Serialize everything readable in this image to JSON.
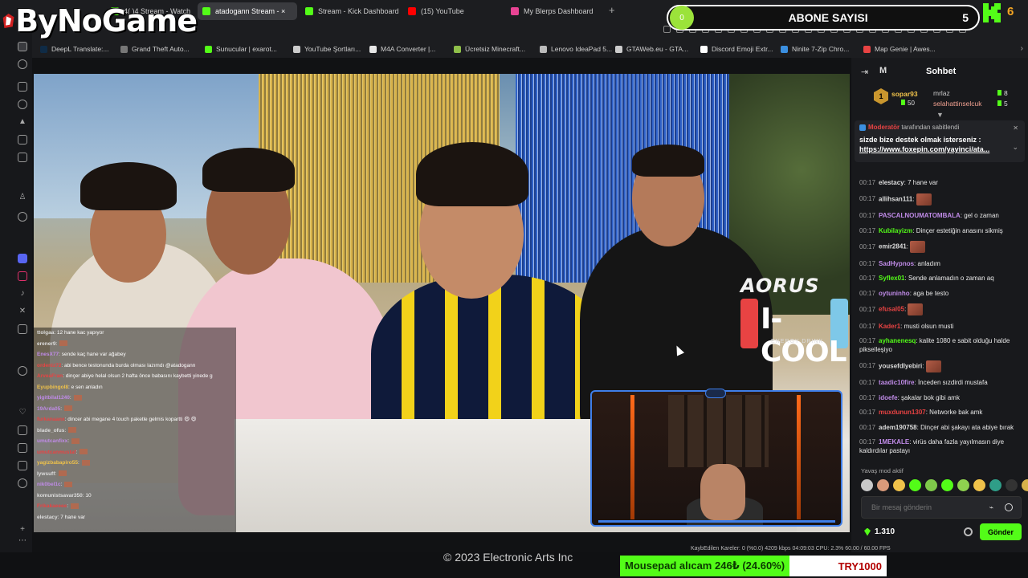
{
  "logo": {
    "text": "ByNoGame"
  },
  "tabs": [
    {
      "label": "4( )4 Stream - Watch",
      "color": "#53fc18"
    },
    {
      "label": "atadogann Stream - ×",
      "color": "#53fc18",
      "active": true
    },
    {
      "label": "Stream - Kick Dashboard",
      "color": "#53fc18"
    },
    {
      "label": "(15) YouTube",
      "color": "#ff0000"
    },
    {
      "label": "My Blerps Dashboard",
      "color": "#e84393"
    }
  ],
  "abone": {
    "label": "ABONE SAYISI",
    "count": "5",
    "ball": "0"
  },
  "kick_count": "6",
  "bookmarks": [
    {
      "label": "DeepL Translate:...",
      "color": "#0f2b46"
    },
    {
      "label": "Grand Theft Auto...",
      "color": "#777777"
    },
    {
      "label": "Sunucular | exarot...",
      "color": "#53fc18"
    },
    {
      "label": "YouTube Şortları...",
      "color": "#cccccc"
    },
    {
      "label": "M4A Converter |...",
      "color": "#e6e6e6"
    },
    {
      "label": "Ücretsiz Minecraft...",
      "color": "#8fbf4a"
    },
    {
      "label": "Lenovo IdeaPad 5...",
      "color": "#bbbbbb"
    },
    {
      "label": "GTAWeb.eu - GTA...",
      "color": "#cccccc"
    },
    {
      "label": "Discord Emoji Extr...",
      "color": "#ffffff"
    },
    {
      "label": "Ninite 7-Zip Chro...",
      "color": "#3b8fe0"
    },
    {
      "label": "Map Genie | Awes...",
      "color": "#e84343"
    }
  ],
  "video": {
    "aorus": "AORUS",
    "icool": "I-COOL",
    "energy": "ENERGY DRINK"
  },
  "overlay_chat": [
    {
      "u": "ttolgaa",
      "m": ": 12 hane kac yapıyor",
      "c": "#dddddd"
    },
    {
      "u": "erener9",
      "m": ":",
      "c": "#dddddd",
      "emo": true
    },
    {
      "u": "EnesX77",
      "m": ": sende kaç hane var ağabey",
      "c": "#c08be8"
    },
    {
      "u": "ordeniz72",
      "m": ": abi bence testonunda burda olması lazımdı @atadogann",
      "c": "#e84343"
    },
    {
      "u": "ArveaFran",
      "m": ": dinçer abiye helal olsun 2 hafta önce babasını kaybetti yinede g",
      "c": "#e84343"
    },
    {
      "u": "Eyupbingol8",
      "m": ": e sen anladın",
      "c": "#f0c24a"
    },
    {
      "u": "yigitbilal1240",
      "m": ":",
      "c": "#c08be8",
      "emo": true
    },
    {
      "u": "19Arda05",
      "m": ":",
      "c": "#c08be8",
      "emo": true
    },
    {
      "u": "furkanaanx",
      "m": ": dincer abi megane 4 touch paketle gelmis kopartti 😄 😄",
      "c": "#e84343"
    },
    {
      "u": "blade_ofus",
      "m": ":",
      "c": "#dddddd",
      "emo": true
    },
    {
      "u": "umutcanfixx",
      "m": ":",
      "c": "#c08be8",
      "emo": true
    },
    {
      "u": "umutcanmustaf",
      "m": ":",
      "c": "#e84343",
      "emo": true
    },
    {
      "u": "yagizbabapiro55",
      "m": ":",
      "c": "#f0c24a",
      "emo": true
    },
    {
      "u": "lywsuff",
      "m": ":",
      "c": "#dddddd",
      "emo": true
    },
    {
      "u": "nik0bel1c",
      "m": ":",
      "c": "#c08be8",
      "emo": true
    },
    {
      "u": "komunistsavar350",
      "m": ": 10",
      "c": "#dddddd"
    },
    {
      "u": "Frikakaeeee",
      "m": ":",
      "c": "#e84343",
      "emo": true
    },
    {
      "u": "elestacy",
      "m": ": 7 hane var",
      "c": "#dddddd"
    }
  ],
  "chat": {
    "title": "Sohbet",
    "m_label": "M",
    "leader": {
      "first": "sopar93",
      "first_score": "50",
      "second": "mrlaz",
      "second_score": "8",
      "third": "selahattinselcuk",
      "third_score": "5",
      "rank": "1"
    },
    "pinned": {
      "who": "Moderatör",
      "by": "tarafından sabitlendi",
      "text": "sizde bize destek olmak isterseniz :",
      "link": "https://www.foxepin.com/yayinci/ata..."
    },
    "messages": [
      {
        "t": "00:17",
        "u": "elestacy",
        "m": " 7 hane var",
        "c": "#dddddd"
      },
      {
        "t": "00:17",
        "u": "allihsan111",
        "m": "",
        "c": "#dddddd",
        "emo": true
      },
      {
        "t": "00:17",
        "u": "PASCALNOUMATOMBALA",
        "m": " gel o zaman",
        "c": "#c08be8"
      },
      {
        "t": "00:17",
        "u": "Kubilayizm",
        "m": " Dinçer estetiğin anasını sikmiş",
        "c": "#53fc18"
      },
      {
        "t": "00:17",
        "u": "emir2841",
        "m": "",
        "c": "#dddddd",
        "emo": true
      },
      {
        "t": "00:17",
        "u": "SadHypnos",
        "m": " anladım",
        "c": "#c08be8"
      },
      {
        "t": "00:17",
        "u": "Syflex01",
        "m": " Sende anlamadın o zaman aq",
        "c": "#53fc18"
      },
      {
        "t": "00:17",
        "u": "oytuninho",
        "m": " aga be testo",
        "c": "#c08be8"
      },
      {
        "t": "00:17",
        "u": "efusal05",
        "m": "",
        "c": "#e84343",
        "emo": true
      },
      {
        "t": "00:17",
        "u": "Kader1",
        "m": " musti olsun musti",
        "c": "#e84343"
      },
      {
        "t": "00:17",
        "u": "ayhanenesq",
        "m": " kalite 1080 e sabit olduğu halde pikselleşiyo",
        "c": "#53fc18"
      },
      {
        "t": "00:17",
        "u": "yousefdlyebiri",
        "m": "",
        "c": "#dddddd",
        "emo": true
      },
      {
        "t": "00:17",
        "u": "taadic10fire",
        "m": " İnceden sızdirdi mustafa",
        "c": "#c08be8"
      },
      {
        "t": "00:17",
        "u": "idoefe",
        "m": " şakalar bok gibi amk",
        "c": "#c08be8"
      },
      {
        "t": "00:17",
        "u": "muxdunun1307",
        "m": " Networke bak amk",
        "c": "#e84343"
      },
      {
        "t": "00:17",
        "u": "adem190758",
        "m": " Dinçer abi şakayı ata abiye bırak",
        "c": "#dddddd"
      },
      {
        "t": "00:17",
        "u": "1MEKALE",
        "m": " virüs daha fazla yayılmasın diye kaldırdılar pastayı",
        "c": "#c08be8"
      }
    ],
    "slow_mode": "Yavaş mod aktif",
    "input_placeholder": "Bir mesaj gönderin",
    "points": "1.310",
    "send_label": "Gönder"
  },
  "bottom": {
    "ea": "© 2023 Electronic Arts Inc",
    "stat": "KaybEdilen Kareler: 0 (%0.0)     4209 kbps     04:09:03     CPU: 2.3%     60.00 / 60.00 FPS",
    "sale_tag": "Mousepad alıcam 246₺ (24.60%)",
    "sale_price": "TRY1000"
  },
  "emote_colors": [
    "#c9c9c9",
    "#d99a7a",
    "#f0c24a",
    "#53fc18",
    "#7fc94a",
    "#53fc18",
    "#8fd14f",
    "#f0c24a",
    "#2f9e88",
    "#333333",
    "#d8b24a"
  ]
}
